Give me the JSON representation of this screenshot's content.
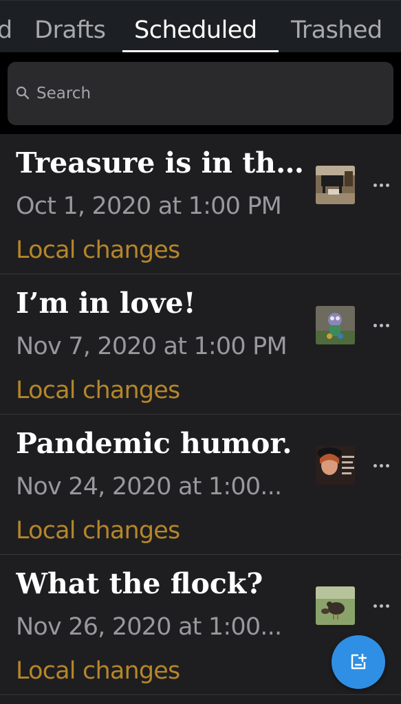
{
  "tabs": [
    {
      "label": "d",
      "active": false
    },
    {
      "label": "Drafts",
      "active": false
    },
    {
      "label": "Scheduled",
      "active": true
    },
    {
      "label": "Trashed",
      "active": false
    }
  ],
  "search": {
    "placeholder": "Search",
    "value": ""
  },
  "posts": [
    {
      "title": "Treasure is in th...",
      "date": "Oct 1, 2020 at 1:00 PM",
      "status": "Local changes",
      "thumb": "piano-room-photo"
    },
    {
      "title": "I’m in love!",
      "date": "Nov 7, 2020 at 1:00 PM",
      "status": "Local changes",
      "thumb": "garden-decoration-photo"
    },
    {
      "title": "Pandemic humor.",
      "date": "Nov 24, 2020 at 1:00...",
      "status": "Local changes",
      "thumb": "witch-meme-photo"
    },
    {
      "title": "What the flock?",
      "date": "Nov 26, 2020 at 1:00...",
      "status": "Local changes",
      "thumb": "turkey-photo"
    }
  ],
  "colors": {
    "accent": "#2f8fe4",
    "status": "#b5862a",
    "background": "#1e1e20"
  },
  "icons": {
    "search": "search-icon",
    "more": "more-icon",
    "compose": "new-post-icon"
  }
}
